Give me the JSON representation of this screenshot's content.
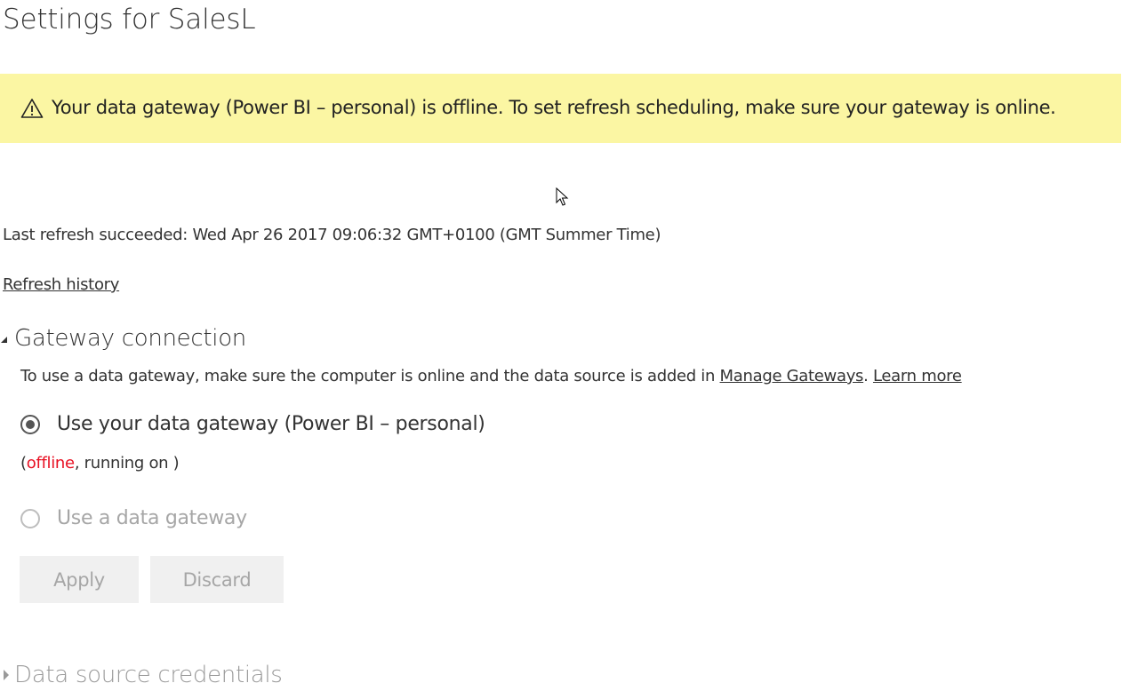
{
  "page": {
    "title": "Settings for SalesL"
  },
  "warning": {
    "text": "Your data gateway (Power BI – personal) is offline. To set refresh scheduling, make sure your gateway is online.",
    "icon": "warning-icon",
    "background": "#fbf6a3"
  },
  "refresh": {
    "last_refresh": "Last refresh succeeded: Wed Apr 26 2017 09:06:32 GMT+0100 (GMT Summer Time)",
    "history_link": "Refresh history"
  },
  "gateway_connection": {
    "title": "Gateway connection",
    "expanded": true,
    "description_prefix": "To use a data gateway, make sure the computer is online and the data source is added in ",
    "manage_gateways_link": "Manage Gateways",
    "description_sep": ". ",
    "learn_more_link": "Learn more",
    "options": [
      {
        "label": "Use your data gateway (Power BI – personal)",
        "selected": true,
        "enabled": true
      },
      {
        "label": "Use a data gateway",
        "selected": false,
        "enabled": false
      }
    ],
    "status_open": "(",
    "status_offline": "offline",
    "status_rest": ", running on )",
    "offline_color": "#e81123",
    "apply_label": "Apply",
    "discard_label": "Discard"
  },
  "data_source_credentials": {
    "title": "Data source credentials",
    "expanded": false
  }
}
